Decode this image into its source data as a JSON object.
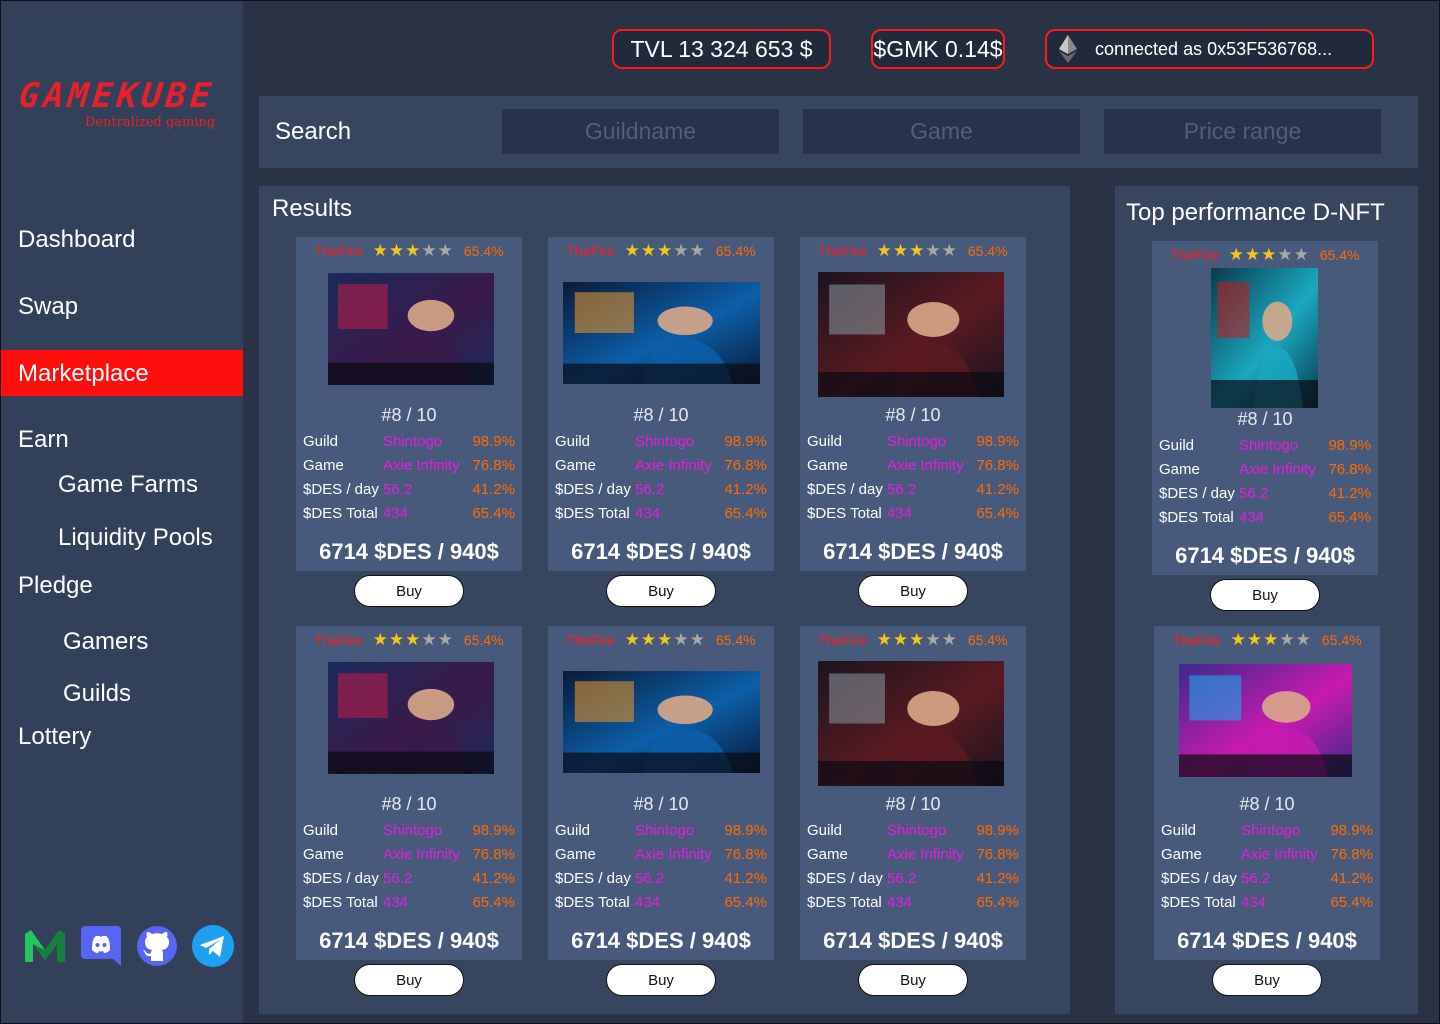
{
  "brand": {
    "logo": "GAMEKUBE",
    "tagline": "Dentralized gaming"
  },
  "nav": {
    "dashboard": "Dashboard",
    "swap": "Swap",
    "marketplace": "Marketplace",
    "earn": "Earn",
    "game_farms": "Game Farms",
    "liquidity_pools": "Liquidity Pools",
    "pledge": "Pledge",
    "gamers": "Gamers",
    "guilds": "Guilds",
    "lottery": "Lottery"
  },
  "socials": [
    "medium-icon",
    "discord-icon",
    "github-icon",
    "telegram-icon"
  ],
  "header": {
    "tvl": "TVL 13 324 653 $",
    "gmk": "$GMK 0.14$",
    "wallet": "connected as 0x53F536768...",
    "wallet_icon": "ethereum-icon"
  },
  "search": {
    "label": "Search",
    "guildname_placeholder": "Guildname",
    "game_placeholder": "Game",
    "price_placeholder": "Price range"
  },
  "results": {
    "title": "Results"
  },
  "top": {
    "title": "Top  performance D-NFT"
  },
  "card": {
    "name": "TheFire",
    "rating": 3,
    "rating_max": 5,
    "rating_pct": "65.4%",
    "rank": "#8 / 10",
    "rows": [
      {
        "label": "Guild",
        "value": "Shintogo",
        "pct": "98.9%"
      },
      {
        "label": "Game",
        "value": "Axie Infinity",
        "pct": "76.8%"
      },
      {
        "label": "$DES / day",
        "value": "56.2",
        "pct": "41.2%"
      },
      {
        "label": "$DES Total",
        "value": "434",
        "pct": "65.4%"
      }
    ],
    "price": "6714 $DES / 940$",
    "buy": "Buy"
  },
  "colors": {
    "accent": "#ff0e0e",
    "sidebar": "#334059",
    "card": "#485a7c",
    "value": "#e81bdd",
    "percent": "#ff6a00"
  }
}
